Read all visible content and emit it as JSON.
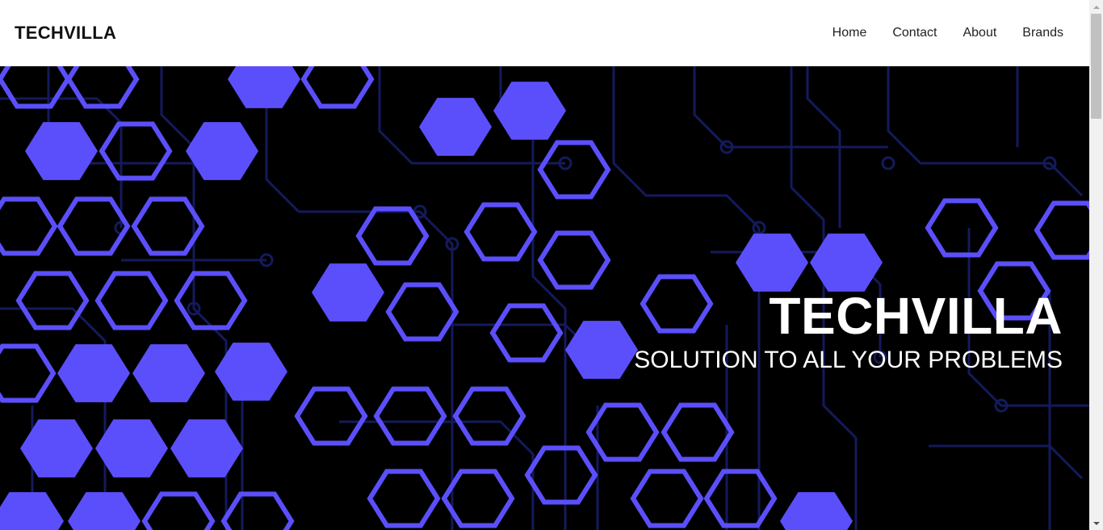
{
  "navbar": {
    "brand": "TECHVILLA",
    "links": [
      {
        "label": "Home"
      },
      {
        "label": "Contact"
      },
      {
        "label": "About"
      },
      {
        "label": "Brands"
      }
    ]
  },
  "hero": {
    "title": "TECHVILLA",
    "subtitle": "SOLUTION TO ALL YOUR PROBLEMS",
    "background_image": "circuit-board-hexagon-pattern",
    "colors": {
      "background": "#000000",
      "accent": "#5b4ffc",
      "circuit": "#141a5c"
    }
  }
}
